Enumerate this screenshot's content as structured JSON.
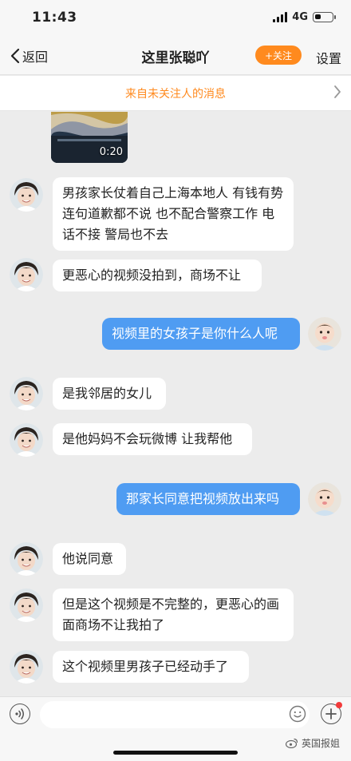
{
  "status_bar": {
    "time": "11:43",
    "network": "4G",
    "battery_level": 0.35
  },
  "nav": {
    "back_label": "返回",
    "title": "这里张聪吖",
    "follow_label": "+关注",
    "settings_label": "设置"
  },
  "notice": {
    "text": "来自未关注人的消息"
  },
  "video": {
    "duration": "0:20"
  },
  "messages": [
    {
      "side": "left",
      "text": "男孩家长仗着自己上海本地人 有钱有势连句道歉都不说 也不配合警察工作 电话不接 警局也不去"
    },
    {
      "side": "left",
      "text": "更恶心的视频没拍到，商场不让"
    },
    {
      "side": "right",
      "text": "视频里的女孩子是你什么人呢"
    },
    {
      "side": "left",
      "text": "是我邻居的女儿"
    },
    {
      "side": "left",
      "text": "是他妈妈不会玩微博 让我帮他"
    },
    {
      "side": "right",
      "text": "那家长同意把视频放出来吗"
    },
    {
      "side": "left",
      "text": "他说同意"
    },
    {
      "side": "left",
      "text": "但是这个视频是不完整的，更恶心的画面商场不让我拍了"
    },
    {
      "side": "left",
      "text": "这个视频里男孩子已经动手了"
    }
  ],
  "input": {
    "placeholder": ""
  },
  "watermark": {
    "text": "英国报姐"
  },
  "icons": {
    "back": "chevron-left-icon",
    "notice_arrow": "chevron-right-icon",
    "voice": "voice-icon",
    "emoji": "emoji-icon",
    "plus": "plus-icon",
    "watermark": "weibo-icon"
  },
  "colors": {
    "accent_orange": "#ff8a1e",
    "sent_bubble": "#4f9cf2",
    "received_bubble": "#ffffff",
    "background": "#ececec"
  }
}
